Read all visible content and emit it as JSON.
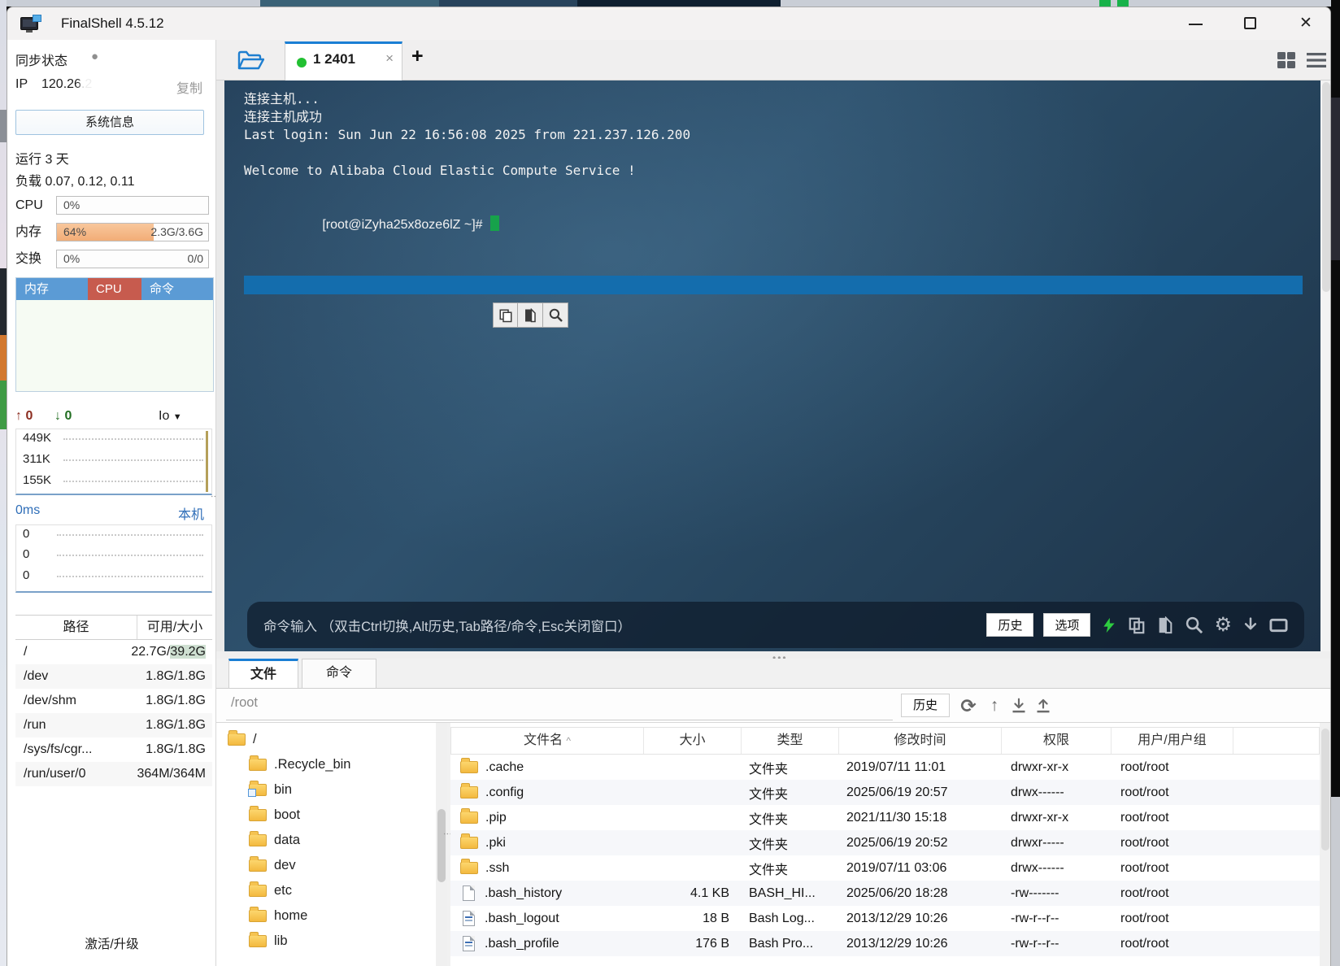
{
  "window": {
    "title": "FinalShell 4.5.12"
  },
  "glyphs": {
    "close_window": "✕",
    "tab_close": "×",
    "new_tab": "+",
    "hamburger_menu": "☰",
    "sort_caret": "^",
    "io_caret": "▼",
    "net_up_arrow": "↑",
    "net_down_arrow": "↓",
    "sync_dot": "●",
    "gear": "⚙",
    "refresh": "⟳",
    "up_dir": "↑",
    "splitter_dots": "⋮",
    "splitter_dots_h": "•••"
  },
  "sidebar": {
    "sync_label": "同步状态",
    "ip_label": "IP",
    "ip_value": "120.26.2",
    "copy_label": "复制",
    "sysinfo_button": "系统信息",
    "uptime": "运行 3 天",
    "load": "负载 0.07, 0.12, 0.11",
    "meters": {
      "cpu_label": "CPU",
      "cpu_value": "0%",
      "mem_label": "内存",
      "mem_value": "64%",
      "mem_detail": "2.3G/3.6G",
      "mem_percent_width": "64%",
      "swap_label": "交换",
      "swap_value": "0%",
      "swap_detail": "0/0"
    },
    "proc_table": {
      "cols": [
        "内存",
        "CPU",
        "命令"
      ]
    },
    "net": {
      "up": "0",
      "down": "0",
      "io": "Io",
      "ticks": [
        "449K",
        "311K",
        "155K"
      ]
    },
    "ping": {
      "latency": "0ms",
      "host": "本机",
      "ticks": [
        "0",
        "0",
        "0"
      ]
    },
    "disk": {
      "col_path": "路径",
      "col_avail": "可用/大小",
      "rows": [
        {
          "path": "/",
          "value": "22.7G/",
          "hl": "39.2G"
        },
        {
          "path": "/dev",
          "value": "1.8G/1.8G",
          "hl": ""
        },
        {
          "path": "/dev/shm",
          "value": "1.8G/1.8G",
          "hl": ""
        },
        {
          "path": "/run",
          "value": "1.8G/1.8G",
          "hl": ""
        },
        {
          "path": "/sys/fs/cgr...",
          "value": "1.8G/1.8G",
          "hl": ""
        },
        {
          "path": "/run/user/0",
          "value": "364M/364M",
          "hl": ""
        }
      ]
    },
    "activate": "激活/升级"
  },
  "tabstrip": {
    "tab": "1 2401"
  },
  "terminal": {
    "lines": [
      "连接主机...",
      "连接主机成功",
      "Last login: Sun Jun 22 16:56:08 2025 from 221.237.126.200",
      "",
      "Welcome to Alibaba Cloud Elastic Compute Service !",
      ""
    ],
    "prompt": "[root@iZyha25x8oze6lZ ~]#",
    "cmdbar": {
      "hint": "命令输入 （双击Ctrl切换,Alt历史,Tab路径/命令,Esc关闭窗口）",
      "history": "历史",
      "options": "选项"
    }
  },
  "bottom": {
    "tab_files": "文件",
    "tab_commands": "命令",
    "path": "/root",
    "history": "历史",
    "tree": [
      "/",
      ".Recycle_bin",
      "bin",
      "boot",
      "data",
      "dev",
      "etc",
      "home",
      "lib"
    ],
    "files": {
      "headers": {
        "name": "文件名",
        "size": "大小",
        "type": "类型",
        "mtime": "修改时间",
        "perm": "权限",
        "owner": "用户/用户组"
      },
      "rows": [
        {
          "name": ".cache",
          "size": "",
          "type": "文件夹",
          "mtime": "2019/07/11 11:01",
          "perm": "drwxr-xr-x",
          "owner": "root/root"
        },
        {
          "name": ".config",
          "size": "",
          "type": "文件夹",
          "mtime": "2025/06/19 20:57",
          "perm": "drwx------",
          "owner": "root/root"
        },
        {
          "name": ".pip",
          "size": "",
          "type": "文件夹",
          "mtime": "2021/11/30 15:18",
          "perm": "drwxr-xr-x",
          "owner": "root/root"
        },
        {
          "name": ".pki",
          "size": "",
          "type": "文件夹",
          "mtime": "2025/06/19 20:52",
          "perm": "drwxr-----",
          "owner": "root/root"
        },
        {
          "name": ".ssh",
          "size": "",
          "type": "文件夹",
          "mtime": "2019/07/11 03:06",
          "perm": "drwx------",
          "owner": "root/root"
        },
        {
          "name": ".bash_history",
          "size": "4.1 KB",
          "type": "BASH_HI...",
          "mtime": "2025/06/20 18:28",
          "perm": "-rw-------",
          "owner": "root/root"
        },
        {
          "name": ".bash_logout",
          "size": "18 B",
          "type": "Bash Log...",
          "mtime": "2013/12/29 10:26",
          "perm": "-rw-r--r--",
          "owner": "root/root"
        },
        {
          "name": ".bash_profile",
          "size": "176 B",
          "type": "Bash Pro...",
          "mtime": "2013/12/29 10:26",
          "perm": "-rw-r--r--",
          "owner": "root/root"
        }
      ]
    }
  },
  "colors": {
    "accent_blue": "#1a7fd4",
    "header_blue": "#5b9bd5",
    "cpu_cell_red": "#c75b4e",
    "mem_orange": "#f2ad77",
    "selection_blue": "#146dad",
    "cursor_green": "#17a24b",
    "folder_yellow": "#f3b93f",
    "disk_highlight": "#cfe0d2"
  }
}
